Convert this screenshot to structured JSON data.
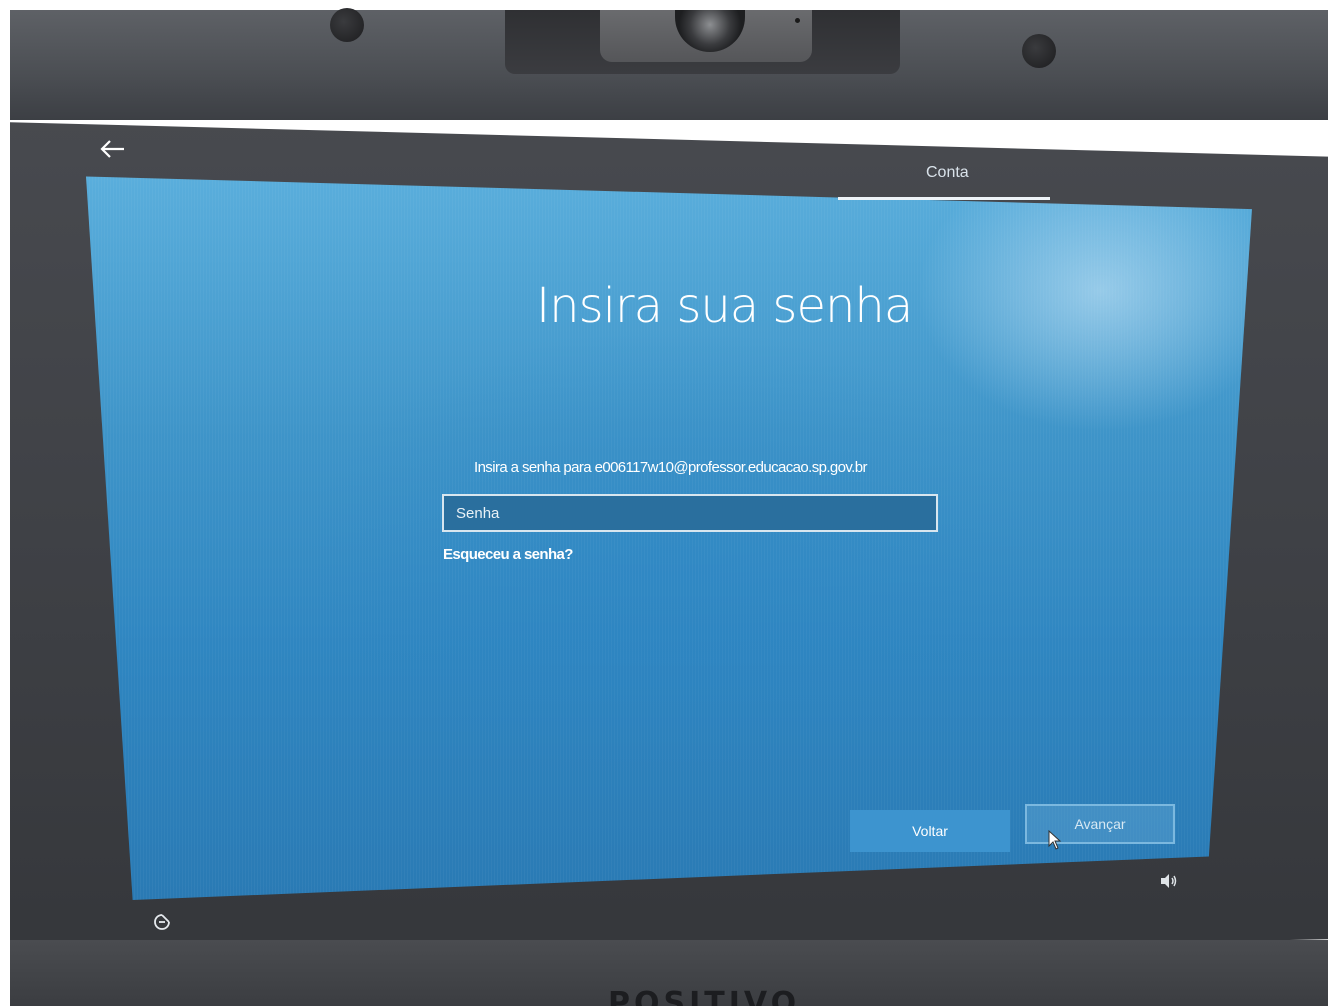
{
  "setup": {
    "tab_label": "Conta",
    "title": "Insira sua senha",
    "instruction": "Insira a senha para e006117w10@professor.educacao.sp.gov.br",
    "password_placeholder": "Senha",
    "forgot_link": "Esqueceu a senha?",
    "back_button": "Voltar",
    "next_button": "Avançar"
  },
  "device": {
    "brand": "POSITIVO"
  },
  "icons": {
    "back": "back-arrow-icon",
    "volume": "volume-icon",
    "ease_of_access": "ease-of-access-icon",
    "cursor": "mouse-cursor-icon"
  },
  "colors": {
    "screen_blue": "#2f86c1",
    "bezel": "#3f4146",
    "back_button": "#3d94cf"
  }
}
